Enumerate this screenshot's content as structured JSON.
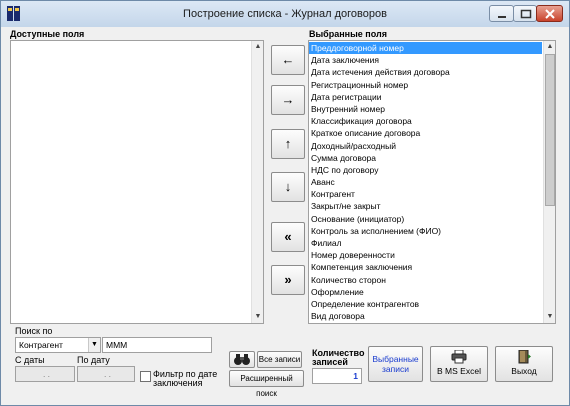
{
  "window": {
    "title": "Построение списка - Журнал договоров"
  },
  "available": {
    "label": "Доступные поля",
    "items": []
  },
  "selected": {
    "label": "Выбранные поля",
    "items": [
      "Преддоговорной номер",
      "Дата заключения",
      "Дата истечения действия договора",
      "Регистрационный номер",
      "Дата регистрации",
      "Внутренний номер",
      "Классификация договора",
      "Краткое описание договора",
      "Доходный/расходный",
      "Сумма договора",
      "НДС по договору",
      "Аванс",
      "Контрагент",
      "Закрыт/не закрыт",
      "Основание (инициатор)",
      "Контроль за исполнением (ФИО)",
      "Филиал",
      "Номер доверенности",
      "Компетенция заключения",
      "Количество сторон",
      "Оформление",
      "Определение контрагентов",
      "Вид договора"
    ],
    "selected_index": 0
  },
  "move_buttons": {
    "move_left": "←",
    "move_right": "→",
    "move_up": "↑",
    "move_down": "↓",
    "move_all_left": "«",
    "move_all_right": "»"
  },
  "search": {
    "label": "Поиск по",
    "field_value": "Контрагент",
    "query": "МММ",
    "date_from_label": "С даты",
    "date_to_label": "По дату",
    "date_from": ". .",
    "date_to": ". .",
    "filter_label_line1": "Фильтр по дате",
    "filter_label_line2": "заключения"
  },
  "buttons": {
    "all_records": "Все записи",
    "advanced_search": "Расширенный поиск",
    "record_count_label_line1": "Количество",
    "record_count_label_line2": "записей",
    "record_count": "1",
    "selected_records_line1": "Выбранные",
    "selected_records_line2": "записи",
    "to_excel": "В MS Excel",
    "exit": "Выход"
  },
  "colors": {
    "selection": "#3399ff",
    "link_blue": "#1a3ccf"
  }
}
